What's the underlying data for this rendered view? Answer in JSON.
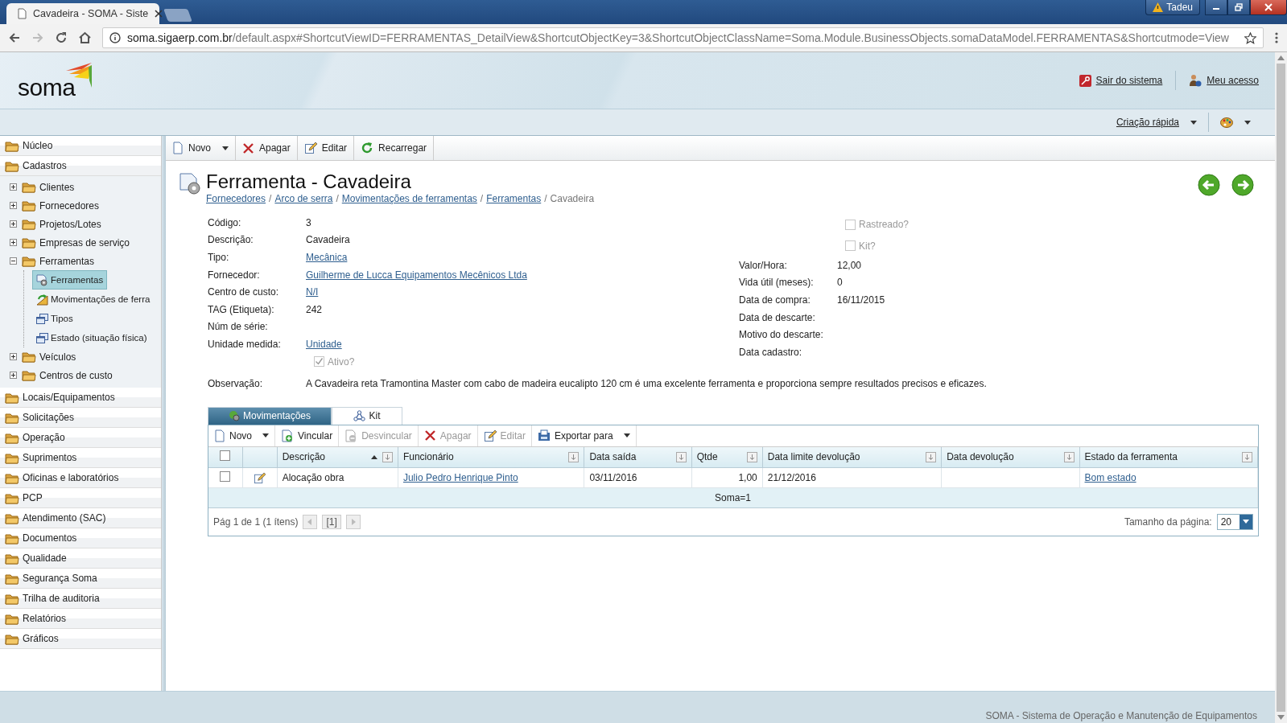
{
  "browser": {
    "tab_title": "Cavadeira - SOMA - Siste",
    "url_host": "soma.sigaerp.com.br",
    "url_path": "/default.aspx#ShortcutViewID=FERRAMENTAS_DetailView&ShortcutObjectKey=3&ShortcutObjectClassName=Soma.Module.BusinessObjects.somaDataModel.FERRAMENTAS&Shortcutmode=View",
    "user": "Tadeu"
  },
  "header": {
    "logo": "soma",
    "links": [
      {
        "label": "Sair do sistema",
        "kind": "logout"
      },
      {
        "label": "Meu acesso",
        "kind": "account"
      }
    ],
    "quick_create": "Criação rápida"
  },
  "sidebar": {
    "groups": [
      {
        "label": "Núcleo"
      },
      {
        "label": "Cadastros",
        "children": [
          {
            "label": "Clientes",
            "expanded": false
          },
          {
            "label": "Fornecedores",
            "expanded": false
          },
          {
            "label": "Projetos/Lotes",
            "expanded": false
          },
          {
            "label": "Empresas de serviço",
            "expanded": false
          },
          {
            "label": "Ferramentas",
            "expanded": true,
            "children": [
              {
                "label": "Ferramentas",
                "kind": "tool",
                "selected": true
              },
              {
                "label": "Movimentações de ferra",
                "kind": "movement",
                "selected": false
              },
              {
                "label": "Tipos",
                "kind": "list",
                "selected": false
              },
              {
                "label": "Estado (situação física)",
                "kind": "list",
                "selected": false
              }
            ]
          },
          {
            "label": "Veículos",
            "expanded": false
          },
          {
            "label": "Centros de custo",
            "expanded": false
          }
        ]
      },
      {
        "label": "Locais/Equipamentos"
      },
      {
        "label": "Solicitações"
      },
      {
        "label": "Operação"
      },
      {
        "label": "Suprimentos"
      },
      {
        "label": "Oficinas e laboratórios"
      },
      {
        "label": "PCP"
      },
      {
        "label": "Atendimento (SAC)"
      },
      {
        "label": "Documentos"
      },
      {
        "label": "Qualidade"
      },
      {
        "label": "Segurança Soma"
      },
      {
        "label": "Trilha de auditoria"
      },
      {
        "label": "Relatórios"
      },
      {
        "label": "Gráficos"
      }
    ]
  },
  "toolbar": [
    {
      "label": "Novo",
      "kind": "new",
      "dropdown": true
    },
    {
      "label": "Apagar",
      "kind": "delete"
    },
    {
      "label": "Editar",
      "kind": "edit"
    },
    {
      "label": "Recarregar",
      "kind": "reload"
    }
  ],
  "detail": {
    "title": "Ferramenta - Cavadeira",
    "breadcrumb_separator": "/",
    "breadcrumb": [
      {
        "text": "Fornecedores",
        "link": true
      },
      {
        "text": "Arco de serra",
        "link": true
      },
      {
        "text": "Movimentações de ferramentas",
        "link": true
      },
      {
        "text": "Ferramentas",
        "link": true
      },
      {
        "text": "Cavadeira",
        "link": false
      }
    ],
    "fields_left": [
      {
        "label": "Código:",
        "value": "3",
        "link": false
      },
      {
        "label": "Descrição:",
        "value": "Cavadeira",
        "link": false
      },
      {
        "label": "Tipo:",
        "value": "Mecânica",
        "link": true
      },
      {
        "label": "Fornecedor:",
        "value": "Guilherme de Lucca Equipamentos Mecênicos Ltda",
        "link": true
      },
      {
        "label": "Centro de custo:",
        "value": "N/I",
        "link": true
      },
      {
        "label": "TAG (Etiqueta):",
        "value": "242",
        "link": false
      },
      {
        "label": "Núm de série:"
      },
      {
        "label": "Unidade medida:",
        "value": "Unidade",
        "link": true
      }
    ],
    "active": {
      "label": "Ativo?",
      "checked": true,
      "disabled": true
    },
    "checks_right": [
      {
        "label": "Rastreado?",
        "checked": false,
        "disabled": true
      },
      {
        "label": "Kit?",
        "checked": false,
        "disabled": true
      }
    ],
    "fields_right": [
      {
        "label": "Valor/Hora:",
        "value": "12,00"
      },
      {
        "label": "Vida útil (meses):",
        "value": "0"
      },
      {
        "label": "Data de compra:",
        "value": "16/11/2015"
      },
      {
        "label": "Data de descarte:"
      },
      {
        "label": "Motivo do descarte:"
      },
      {
        "label": "Data cadastro:"
      }
    ],
    "observation": {
      "label": "Observação:",
      "value": "A Cavadeira reta Tramontina Master com cabo de madeira eucalipto 120 cm é uma excelente ferramenta e proporciona sempre resultados precisos e eficazes."
    }
  },
  "grid": {
    "tabs": [
      {
        "label": "Movimentações",
        "kind": "movements",
        "selected": true
      },
      {
        "label": "Kit",
        "kind": "kit",
        "selected": false
      }
    ],
    "toolbar": [
      {
        "label": "Novo",
        "kind": "new",
        "dropdown": true,
        "disabled": false
      },
      {
        "label": "Vincular",
        "kind": "link",
        "disabled": false
      },
      {
        "label": "Desvincular",
        "kind": "unlink",
        "disabled": true
      },
      {
        "label": "Apagar",
        "kind": "delete",
        "disabled": true
      },
      {
        "label": "Editar",
        "kind": "edit",
        "disabled": true
      },
      {
        "label": "Exportar para",
        "kind": "export",
        "dropdown": true,
        "disabled": false
      }
    ],
    "header_checkbox": {
      "checked": false
    },
    "columns": [
      {
        "label": "Descrição",
        "sorted_ascending": true
      },
      {
        "label": "Funcionário"
      },
      {
        "label": "Data saída"
      },
      {
        "label": "Qtde",
        "kind": "number"
      },
      {
        "label": "Data limite devolução"
      },
      {
        "label": "Data devolução"
      },
      {
        "label": "Estado da ferramenta"
      }
    ],
    "rows": [
      {
        "checked": false,
        "cells": [
          {
            "text": "Alocação obra"
          },
          {
            "text": "Julio Pedro Henrique Pinto",
            "link": true
          },
          {
            "text": "03/11/2016"
          },
          {
            "text": "1,00"
          },
          {
            "text": "21/12/2016"
          },
          null,
          {
            "text": "Bom estado",
            "link": true
          }
        ]
      }
    ],
    "summary": "Soma=1",
    "pager": {
      "info": "Pág 1 de 1 (1 ítens)",
      "page": "[1]",
      "size_label": "Tamanho da página:",
      "size": "20"
    }
  },
  "status_bar": "SOMA - Sistema de Operação e Manutenção de Equipamentos"
}
